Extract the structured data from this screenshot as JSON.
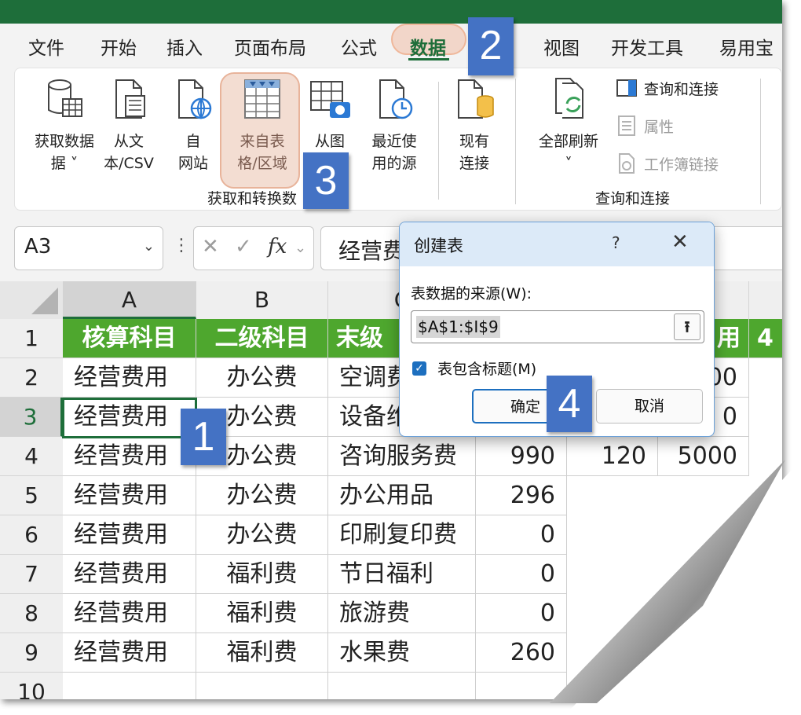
{
  "menu_tabs": [
    "文件",
    "开始",
    "插入",
    "页面布局",
    "公式",
    "数据",
    "视图",
    "开发工具",
    "易用宝"
  ],
  "active_tab": "数据",
  "ribbon": {
    "get_data": "获取数据",
    "get_data_suffix": "据 ˅",
    "from_text_csv": [
      "从文",
      "本/CSV"
    ],
    "from_web": [
      "自",
      "网站"
    ],
    "from_table": [
      "来自表",
      "格/区域"
    ],
    "from_picture": [
      "从图"
    ],
    "recent_sources": [
      "最近使",
      "用的源"
    ],
    "existing_connections": [
      "现有",
      "连接"
    ],
    "group_get_transform": "获取和转换数",
    "refresh_all": "全部刷新",
    "queries_connections": "查询和连接",
    "properties": "属性",
    "workbook_links": "工作簿链接",
    "group_queries": "查询和连接"
  },
  "formula_bar": {
    "name_box": "A3",
    "fx_symbol": "fx",
    "content": "经营费"
  },
  "columns": [
    "A",
    "B",
    "C"
  ],
  "rows": [
    "1",
    "2",
    "3",
    "4",
    "5",
    "6",
    "7",
    "8",
    "9",
    "10"
  ],
  "table_header": [
    "核算科目",
    "二级科目",
    "末级",
    "用",
    "4"
  ],
  "table_rows": [
    {
      "a": "经营费用",
      "b": "办公费",
      "c": "空调费",
      "d": "",
      "e": "",
      "f": "00"
    },
    {
      "a": "经营费用",
      "b": "办公费",
      "c": "设备维",
      "d": "",
      "e": "",
      "f": "0"
    },
    {
      "a": "经营费用",
      "b": "办公费",
      "c": "咨询服务费",
      "d": "990",
      "e": "120",
      "f": "5000"
    },
    {
      "a": "经营费用",
      "b": "办公费",
      "c": "办公用品",
      "d": "296",
      "e": "",
      "f": ""
    },
    {
      "a": "经营费用",
      "b": "办公费",
      "c": "印刷复印费",
      "d": "0",
      "e": "",
      "f": ""
    },
    {
      "a": "经营费用",
      "b": "福利费",
      "c": "节日福利",
      "d": "0",
      "e": "",
      "f": ""
    },
    {
      "a": "经营费用",
      "b": "福利费",
      "c": "旅游费",
      "d": "0",
      "e": "",
      "f": ""
    },
    {
      "a": "经营费用",
      "b": "福利费",
      "c": "水果费",
      "d": "260",
      "e": "",
      "f": ""
    }
  ],
  "dialog": {
    "title": "创建表",
    "help": "?",
    "close": "✕",
    "source_label": "表数据的来源(W):",
    "source_value": "$A$1:$I$9",
    "collapse": "⭱",
    "has_headers": "表包含标题(M)",
    "ok": "确定",
    "cancel": "取消"
  },
  "steps": [
    "1",
    "2",
    "3",
    "4"
  ],
  "colors": {
    "title_bar": "#1e6e3a",
    "header_fill": "#4ea72e",
    "badge": "#4472c4",
    "highlight": "#f3ddd2"
  }
}
